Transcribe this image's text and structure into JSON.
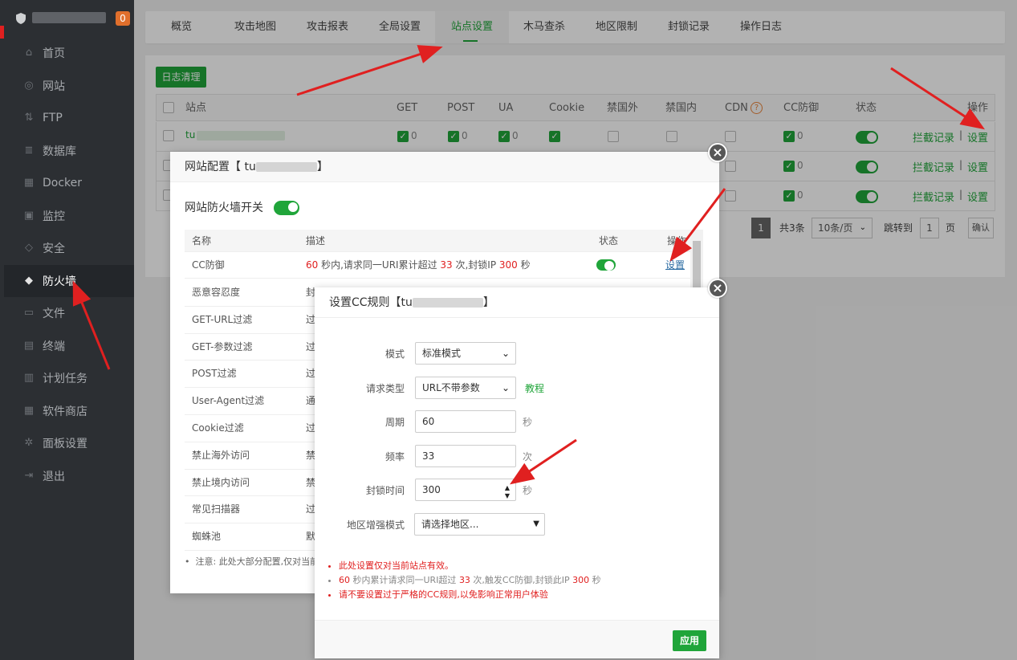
{
  "sidebar": {
    "badge": "0",
    "items": [
      {
        "label": "首页",
        "icon": "home-icon"
      },
      {
        "label": "网站",
        "icon": "globe-icon"
      },
      {
        "label": "FTP",
        "icon": "ftp-icon"
      },
      {
        "label": "数据库",
        "icon": "database-icon"
      },
      {
        "label": "Docker",
        "icon": "docker-icon"
      },
      {
        "label": "监控",
        "icon": "monitor-icon"
      },
      {
        "label": "安全",
        "icon": "shield-icon"
      },
      {
        "label": "防火墙",
        "icon": "firewall-icon"
      },
      {
        "label": "文件",
        "icon": "folder-icon"
      },
      {
        "label": "终端",
        "icon": "terminal-icon"
      },
      {
        "label": "计划任务",
        "icon": "calendar-icon"
      },
      {
        "label": "软件商店",
        "icon": "grid-icon"
      },
      {
        "label": "面板设置",
        "icon": "gear-icon"
      },
      {
        "label": "退出",
        "icon": "logout-icon"
      }
    ]
  },
  "tabs": [
    "概览",
    "攻击地图",
    "攻击报表",
    "全局设置",
    "站点设置",
    "木马查杀",
    "地区限制",
    "封锁记录",
    "操作日志"
  ],
  "toolbar": {
    "clear_log": "日志清理"
  },
  "table": {
    "headers": {
      "site": "站点",
      "get": "GET",
      "post": "POST",
      "ua": "UA",
      "cookie": "Cookie",
      "no_abroad": "禁国外",
      "no_domestic": "禁国内",
      "cdn": "CDN",
      "cc": "CC防御",
      "status": "状态",
      "ops": "操作"
    },
    "first_site_prefix": "tu",
    "count_zero": "0",
    "ops_log": "拦截记录",
    "ops_sep": "|",
    "ops_settings": "设置"
  },
  "pager": {
    "current": "1",
    "total": "共3条",
    "per_page": "10条/页",
    "goto": "跳转到",
    "goto_value": "1",
    "page_unit": "页",
    "confirm": "确认"
  },
  "dialog1": {
    "title_prefix": "网站配置【 tu",
    "title_suffix": "】",
    "switch_label": "网站防火墙开关",
    "headers": {
      "name": "名称",
      "desc": "描述",
      "status": "状态",
      "ops": "操作"
    },
    "cc_row": {
      "name": "CC防御",
      "p1": "60",
      "t1": " 秒内,请求同一URI累计超过 ",
      "p2": "33",
      "t2": " 次,封锁IP ",
      "p3": "300",
      "t3": " 秒",
      "ops": "设置"
    },
    "rows": [
      {
        "name": "恶意容忍度",
        "desc": "封"
      },
      {
        "name": "GET-URL过滤",
        "desc": "过"
      },
      {
        "name": "GET-参数过滤",
        "desc": "过"
      },
      {
        "name": "POST过滤",
        "desc": "过"
      },
      {
        "name": "User-Agent过滤",
        "desc": "通"
      },
      {
        "name": "Cookie过滤",
        "desc": "过"
      },
      {
        "name": "禁止海外访问",
        "desc": "禁"
      },
      {
        "name": "禁止境内访问",
        "desc": "禁"
      },
      {
        "name": "常见扫描器",
        "desc": "过"
      },
      {
        "name": "蜘蛛池",
        "desc": "默"
      }
    ],
    "note": "注意: 此处大部分配置,仅对当前"
  },
  "dialog2": {
    "title_prefix": "设置CC规则【tu",
    "title_suffix": "】",
    "mode_label": "模式",
    "mode_value": "标准模式",
    "req_label": "请求类型",
    "req_value": "URL不带参数",
    "tutorial": "教程",
    "period_label": "周期",
    "period_value": "60",
    "period_unit": "秒",
    "freq_label": "频率",
    "freq_value": "33",
    "freq_unit": "次",
    "block_label": "封锁时间",
    "block_value": "300",
    "block_unit": "秒",
    "region_label": "地区增强模式",
    "region_value": "请选择地区...",
    "note1": "此处设置仅对当前站点有效。",
    "note2": {
      "p1": "60",
      "t1": " 秒内累计请求同一URI超过 ",
      "p2": "33",
      "t2": " 次,触发CC防御,封锁此IP ",
      "p3": "300",
      "t3": " 秒"
    },
    "note3": "请不要设置过于严格的CC规则,以免影响正常用户体验",
    "apply": "应用"
  },
  "colors": {
    "accent": "#20a53a",
    "annotation": "#e02020",
    "sidebar": "#2c2f33"
  }
}
